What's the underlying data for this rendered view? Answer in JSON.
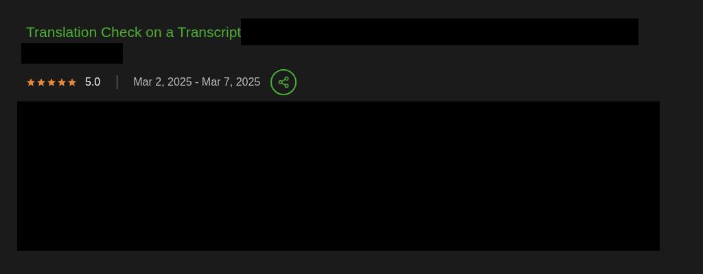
{
  "project": {
    "title": "Translation Check on a Transcript",
    "stars": 5,
    "rating": "5.0",
    "dates": "Mar 2, 2025 - Mar 7, 2025"
  }
}
